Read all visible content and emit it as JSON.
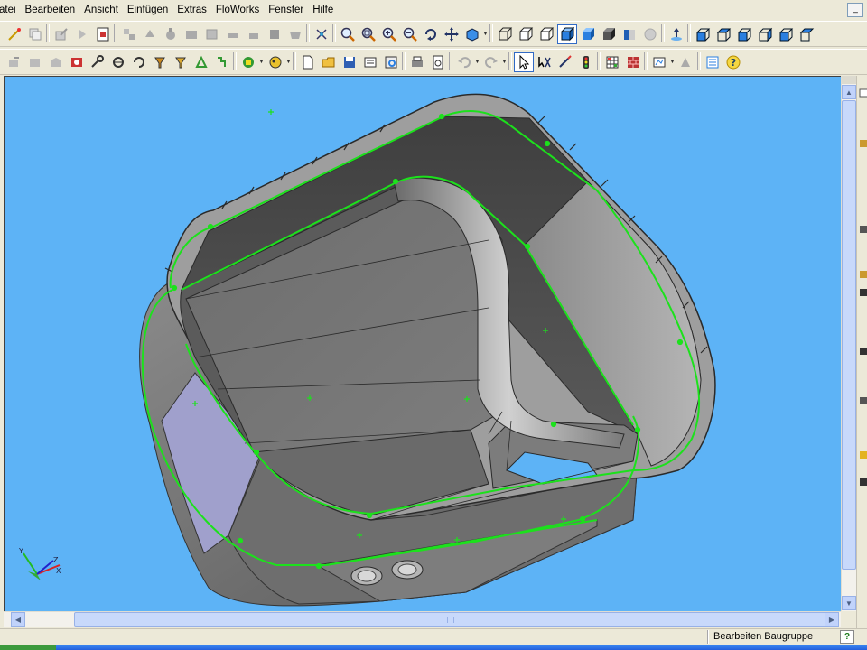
{
  "menu": {
    "items": [
      "atei",
      "Bearbeiten",
      "Ansicht",
      "Einfügen",
      "Extras",
      "FloWorks",
      "Fenster",
      "Hilfe"
    ],
    "minimize_glyph": "_"
  },
  "toolbar1": {
    "icons": [
      "sketch-line-icon",
      "copy-icon",
      "edit-component-icon",
      "arrow-icon",
      "insert-component-icon",
      "mate-icon",
      "move-component-icon",
      "rotate-component-icon",
      "exploded-view-icon",
      "hide-show-icon",
      "smart-fastener-icon",
      "feature-icon",
      "assembly-feature-icon",
      "zoom-to-fit-icon",
      "zoom-window-icon",
      "zoom-in-out-icon",
      "zoom-selection-icon",
      "rotate-view-icon",
      "pan-icon",
      "view-orientation-icon",
      "wireframe-icon",
      "hidden-lines-visible-icon",
      "hidden-lines-removed-icon",
      "shaded-with-edges-icon",
      "shaded-icon",
      "shadows-icon",
      "section-view-icon",
      "realview-icon",
      "normal-to-icon",
      "front-view-icon",
      "back-view-icon",
      "left-view-icon",
      "right-view-icon",
      "top-view-icon"
    ]
  },
  "toolbar2": {
    "icons": [
      "move-icon",
      "gear-icon",
      "sheet-metal-icon",
      "rotate-icon",
      "tools-icon",
      "weldment-icon",
      "mold-icon",
      "surface-icon",
      "split-icon",
      "recycle-icon",
      "options-icon",
      "new-document-icon",
      "open-folder-icon",
      "save-icon",
      "print-icon",
      "print-preview-icon",
      "undo-icon",
      "redo-icon",
      "select-icon",
      "select-other-icon",
      "edit-sketch-icon",
      "traffic-light-icon",
      "grid-icon",
      "brick-material-icon",
      "sensor-icon",
      "rebuild-icon",
      "list-properties-icon",
      "help-icon"
    ]
  },
  "statusbar": {
    "text": "Bearbeiten Baugruppe",
    "help_glyph": "?"
  },
  "scroll": {
    "up": "▲",
    "down": "▼",
    "left": "◀",
    "right": "▶"
  },
  "triad": {
    "x": "X",
    "y": "Y",
    "z": "Z"
  },
  "colors": {
    "viewport_bg": "#5db3f6",
    "part_gray": "#7a7a7a",
    "sketch_green": "#1ce11c",
    "selected_face": "#a0a0cc"
  }
}
